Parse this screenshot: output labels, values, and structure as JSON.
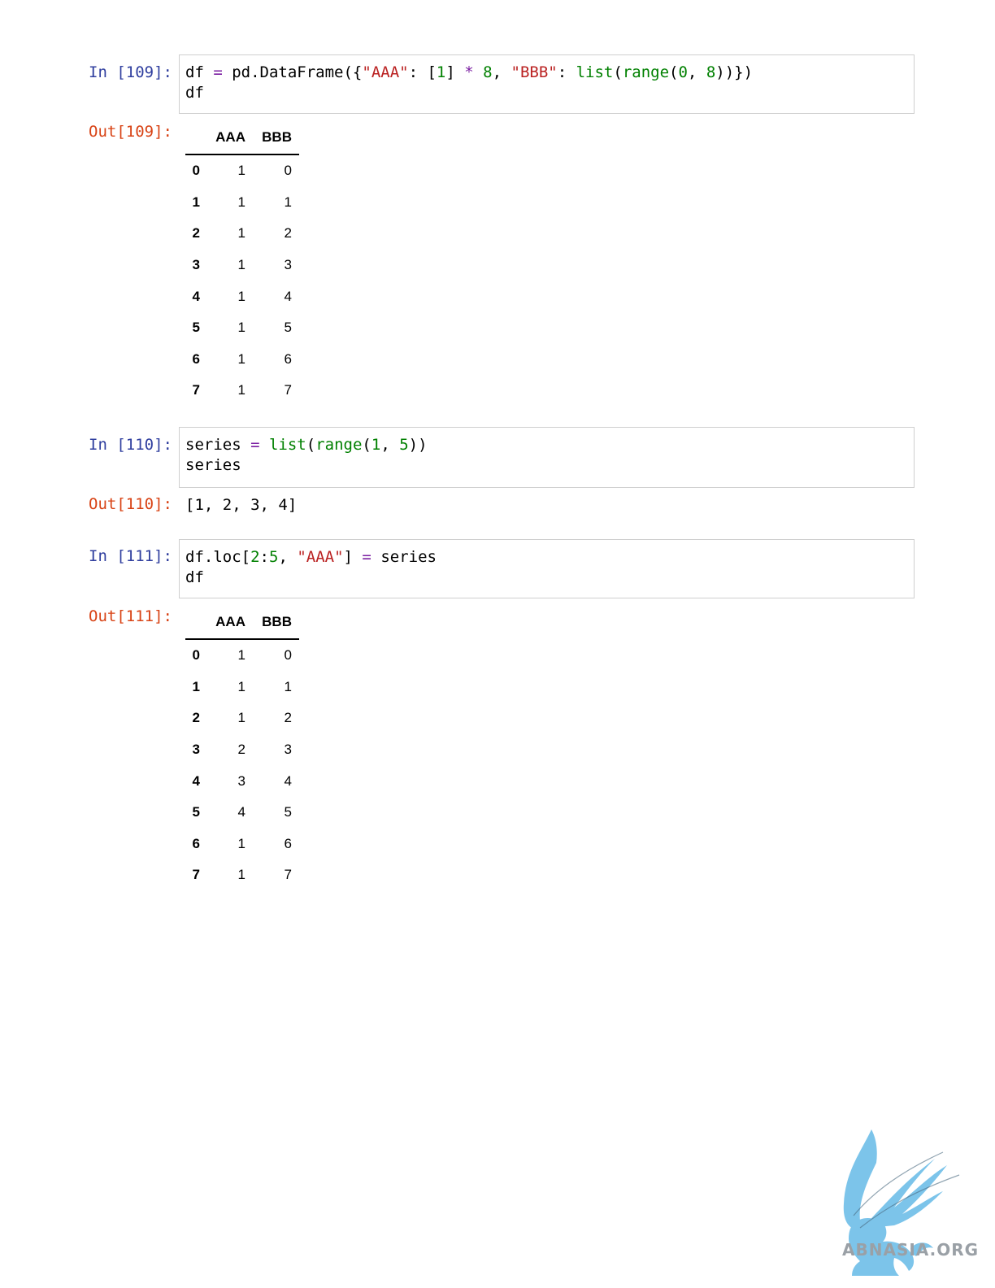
{
  "cells": [
    {
      "in_prompt": "In [109]:",
      "code": [
        [
          {
            "t": "df "
          },
          {
            "t": "=",
            "c": "op"
          },
          {
            "t": " pd.DataFrame({"
          },
          {
            "t": "\"AAA\"",
            "c": "str"
          },
          {
            "t": ": ["
          },
          {
            "t": "1",
            "c": "num"
          },
          {
            "t": "] "
          },
          {
            "t": "*",
            "c": "op"
          },
          {
            "t": " "
          },
          {
            "t": "8",
            "c": "num"
          },
          {
            "t": ", "
          },
          {
            "t": "\"BBB\"",
            "c": "str"
          },
          {
            "t": ": "
          },
          {
            "t": "list",
            "c": "bi"
          },
          {
            "t": "("
          },
          {
            "t": "range",
            "c": "bi"
          },
          {
            "t": "("
          },
          {
            "t": "0",
            "c": "num"
          },
          {
            "t": ", "
          },
          {
            "t": "8",
            "c": "num"
          },
          {
            "t": "))})"
          }
        ],
        [
          {
            "t": "df"
          }
        ]
      ],
      "out_prompt": "Out[109]:",
      "table": {
        "columns": [
          "AAA",
          "BBB"
        ],
        "rows": [
          {
            "index": "0",
            "AAA": "1",
            "BBB": "0"
          },
          {
            "index": "1",
            "AAA": "1",
            "BBB": "1"
          },
          {
            "index": "2",
            "AAA": "1",
            "BBB": "2"
          },
          {
            "index": "3",
            "AAA": "1",
            "BBB": "3"
          },
          {
            "index": "4",
            "AAA": "1",
            "BBB": "4"
          },
          {
            "index": "5",
            "AAA": "1",
            "BBB": "5"
          },
          {
            "index": "6",
            "AAA": "1",
            "BBB": "6"
          },
          {
            "index": "7",
            "AAA": "1",
            "BBB": "7"
          }
        ]
      }
    },
    {
      "in_prompt": "In [110]:",
      "code": [
        [
          {
            "t": "series "
          },
          {
            "t": "=",
            "c": "op"
          },
          {
            "t": " "
          },
          {
            "t": "list",
            "c": "bi"
          },
          {
            "t": "("
          },
          {
            "t": "range",
            "c": "bi"
          },
          {
            "t": "("
          },
          {
            "t": "1",
            "c": "num"
          },
          {
            "t": ", "
          },
          {
            "t": "5",
            "c": "num"
          },
          {
            "t": "))"
          }
        ],
        [
          {
            "t": "series"
          }
        ]
      ],
      "out_prompt": "Out[110]:",
      "text_output": "[1, 2, 3, 4]"
    },
    {
      "in_prompt": "In [111]:",
      "code": [
        [
          {
            "t": "df.loc["
          },
          {
            "t": "2",
            "c": "num"
          },
          {
            "t": ":"
          },
          {
            "t": "5",
            "c": "num"
          },
          {
            "t": ", "
          },
          {
            "t": "\"AAA\"",
            "c": "str"
          },
          {
            "t": "] "
          },
          {
            "t": "=",
            "c": "op"
          },
          {
            "t": " series"
          }
        ],
        [
          {
            "t": "df"
          }
        ]
      ],
      "out_prompt": "Out[111]:",
      "table": {
        "columns": [
          "AAA",
          "BBB"
        ],
        "rows": [
          {
            "index": "0",
            "AAA": "1",
            "BBB": "0"
          },
          {
            "index": "1",
            "AAA": "1",
            "BBB": "1"
          },
          {
            "index": "2",
            "AAA": "1",
            "BBB": "2"
          },
          {
            "index": "3",
            "AAA": "2",
            "BBB": "3"
          },
          {
            "index": "4",
            "AAA": "3",
            "BBB": "4"
          },
          {
            "index": "5",
            "AAA": "4",
            "BBB": "5"
          },
          {
            "index": "6",
            "AAA": "1",
            "BBB": "6"
          },
          {
            "index": "7",
            "AAA": "1",
            "BBB": "7"
          }
        ]
      }
    }
  ],
  "colors": {
    "in_prompt": "#303f9f",
    "out_prompt": "#d84315",
    "operator": "#7b1fa2",
    "string": "#ba2121",
    "number": "#008000",
    "builtin": "#008000",
    "watermark": "#7cc4ea"
  },
  "watermark": {
    "text": "ABNASIA.ORG",
    "icon": "griffin-logo-icon"
  }
}
